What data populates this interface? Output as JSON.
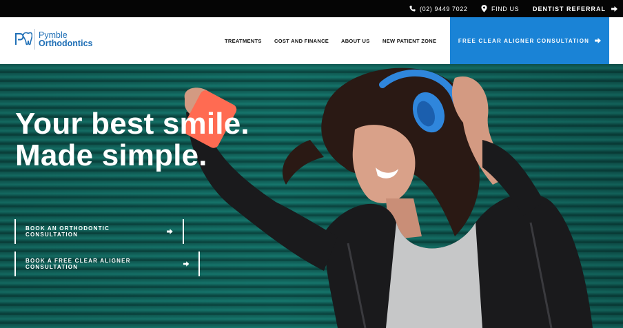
{
  "topbar": {
    "phone": "(02) 9449 7022",
    "find_us": "FIND US",
    "dentist_referral": "DENTIST REFERRAL"
  },
  "logo": {
    "line1": "Pymble",
    "line2": "Orthodontics"
  },
  "nav": {
    "items": [
      "TREATMENTS",
      "COST AND FINANCE",
      "ABOUT US",
      "NEW PATIENT ZONE"
    ],
    "cta": "FREE CLEAR ALIGNER CONSULTATION"
  },
  "hero": {
    "headline_line1": "Your best smile.",
    "headline_line2": "Made simple.",
    "buttons": [
      "BOOK AN ORTHODONTIC CONSULTATION",
      "BOOK A FREE CLEAR ALIGNER CONSULTATION"
    ]
  },
  "colors": {
    "brand_blue": "#1a83d6",
    "topbar_black": "#050505",
    "wall_teal": "#16776d",
    "phone_coral": "#ff6b52",
    "headphones_blue": "#2f86dc"
  }
}
